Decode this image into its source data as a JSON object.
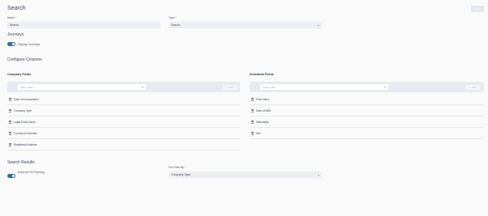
{
  "header": {
    "title": "Search",
    "save_label": "Save"
  },
  "form": {
    "name_label": "Name",
    "name_value": "Search",
    "type_label": "Type",
    "type_value": "Search"
  },
  "journeys": {
    "title": "Journeys",
    "toggle_label": "Display Journeys",
    "toggle_on": true
  },
  "configure": {
    "title": "Configure Columns",
    "company": {
      "title": "Company Fields",
      "select_placeholder": "select value",
      "add_label": "Add",
      "items": [
        "Date of Incorporation",
        "Company Type",
        "Legal Entity Name",
        "Country of Domicile",
        "Registered Address"
      ]
    },
    "individual": {
      "title": "Individual Fields",
      "select_placeholder": "select value",
      "add_label": "Add",
      "items": [
        "First Name",
        "Date of Birth",
        "Nationality",
        "UID"
      ]
    }
  },
  "results": {
    "title": "Search Results",
    "toggle_label": "Enforce Pre Filtering",
    "toggle_on": true,
    "prefilter_label": "Pre Filter By",
    "prefilter_value": "Company Type"
  },
  "colors": {
    "accent": "#2f6fa8",
    "panel": "#e7eaf0",
    "input": "#eceef2"
  }
}
